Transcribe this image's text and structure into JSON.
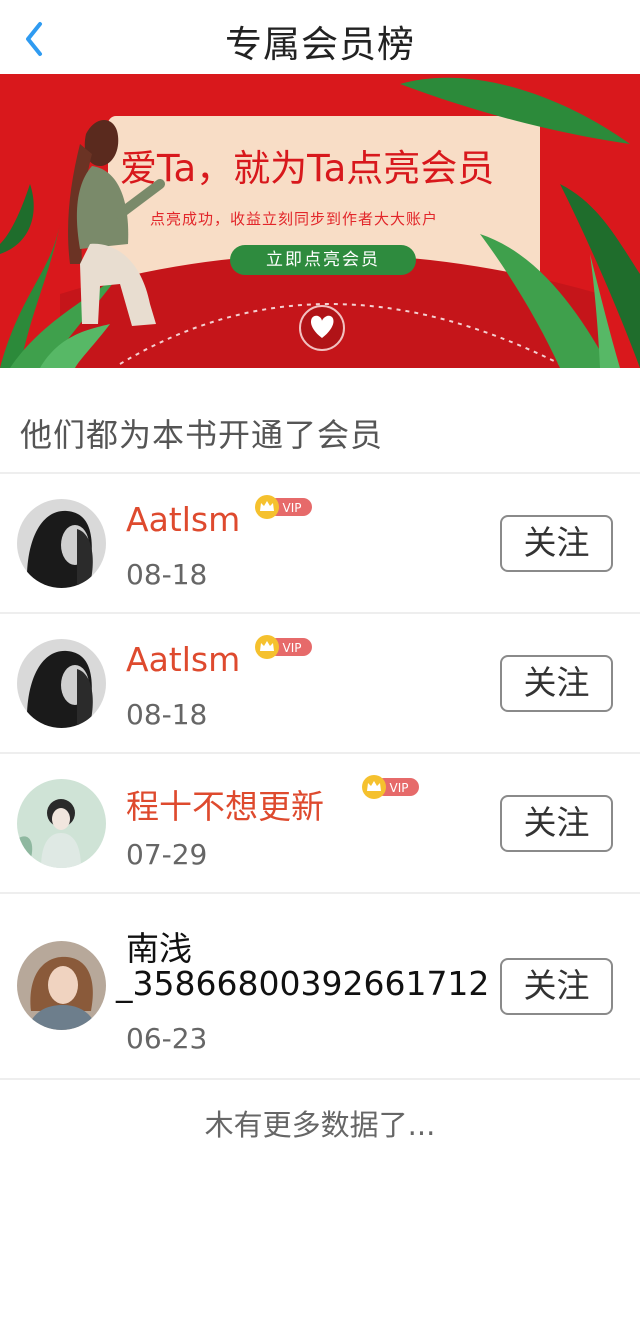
{
  "header": {
    "title": "专属会员榜",
    "back_icon": "chevron-left-icon",
    "accent_color": "#2f9bf1"
  },
  "banner": {
    "headline": "爱Ta，就为Ta点亮会员",
    "subline": "点亮成功，收益立刻同步到作者大大账户",
    "cta_label": "立即点亮会员",
    "background_color": "#d9181c"
  },
  "section_title": "他们都为本书开通了会员",
  "members": [
    {
      "name": "Aatlsm",
      "date": "08-18",
      "vip_label": "VIP",
      "vip": true,
      "follow_label": "关注"
    },
    {
      "name": "Aatlsm",
      "date": "08-18",
      "vip_label": "VIP",
      "vip": true,
      "follow_label": "关注"
    },
    {
      "name": "程十不想更新",
      "date": "07-29",
      "vip_label": "VIP",
      "vip": true,
      "follow_label": "关注"
    },
    {
      "name_line1": "南浅",
      "name_line2": "_3586680039266171​2",
      "date": "06-23",
      "vip": false,
      "follow_label": "关注"
    }
  ],
  "footer_text": "木有更多数据了..."
}
